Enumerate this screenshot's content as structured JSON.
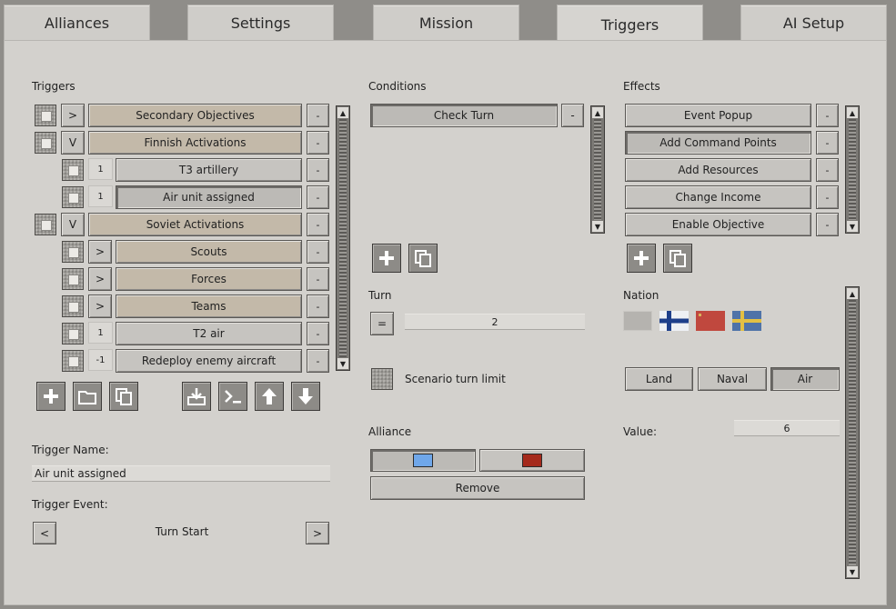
{
  "tabs": [
    {
      "label": "Alliances"
    },
    {
      "label": "Settings"
    },
    {
      "label": "Mission"
    },
    {
      "label": "Triggers"
    },
    {
      "label": "AI Setup"
    }
  ],
  "triggers": {
    "heading": "Triggers",
    "rows": [
      {
        "toggle": ">",
        "label": "Secondary Objectives",
        "remove": "-"
      },
      {
        "toggle": "V",
        "label": "Finnish Activations",
        "remove": "-"
      },
      {
        "toggle": "1",
        "label": "T3 artillery",
        "remove": "-"
      },
      {
        "toggle": "1",
        "label": "Air unit assigned",
        "remove": "-"
      },
      {
        "toggle": "V",
        "label": "Soviet Activations",
        "remove": "-"
      },
      {
        "toggle": ">",
        "label": "Scouts",
        "remove": "-"
      },
      {
        "toggle": ">",
        "label": "Forces",
        "remove": "-"
      },
      {
        "toggle": ">",
        "label": "Teams",
        "remove": "-"
      },
      {
        "toggle": "1",
        "label": "T2 air",
        "remove": "-"
      },
      {
        "toggle": "-1",
        "label": "Redeploy enemy aircraft",
        "remove": "-"
      }
    ],
    "name_label": "Trigger Name:",
    "name_value": "Air unit assigned",
    "event_label": "Trigger Event:",
    "event_prev": "<",
    "event_value": "Turn Start",
    "event_next": ">"
  },
  "conditions": {
    "heading": "Conditions",
    "items": [
      {
        "label": "Check Turn",
        "remove": "-"
      }
    ],
    "turn_label": "Turn",
    "turn_operator": "=",
    "turn_value": "2",
    "scenario_limit_label": "Scenario turn limit",
    "alliance_label": "Alliance",
    "alliance_colors": [
      "#6fa7ea",
      "#a52a1c"
    ],
    "remove_label": "Remove"
  },
  "effects": {
    "heading": "Effects",
    "items": [
      {
        "label": "Event Popup",
        "remove": "-"
      },
      {
        "label": "Add Command Points",
        "remove": "-"
      },
      {
        "label": "Add Resources",
        "remove": "-"
      },
      {
        "label": "Change Income",
        "remove": "-"
      },
      {
        "label": "Enable Objective",
        "remove": "-"
      }
    ],
    "nation_label": "Nation",
    "nations": [
      "none",
      "finland",
      "soviet",
      "sweden"
    ],
    "unit_types": [
      "Land",
      "Naval",
      "Air"
    ],
    "selected_unit_type": "Air",
    "value_label": "Value:",
    "value": "6"
  },
  "icons": {
    "scroll_up": "▲",
    "scroll_down": "▼"
  },
  "colors": {
    "panel": "#d3d1cd",
    "button": "#c6c4c0",
    "tan_button": "#c3b9a9"
  }
}
